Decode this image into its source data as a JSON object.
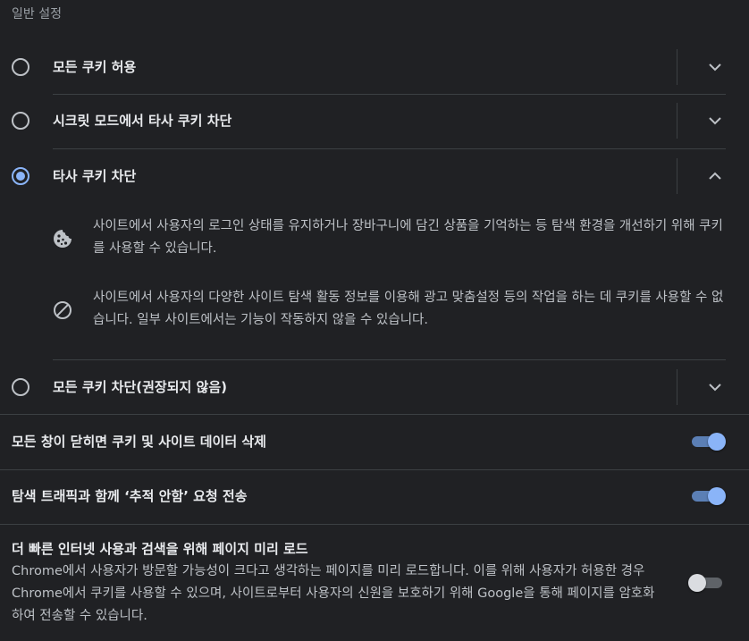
{
  "section": {
    "title": "일반 설정"
  },
  "cookie_options": [
    {
      "label": "모든 쿠키 허용",
      "selected": false,
      "expanded": false
    },
    {
      "label": "시크릿 모드에서 타사 쿠키 차단",
      "selected": false,
      "expanded": false
    },
    {
      "label": "타사 쿠키 차단",
      "selected": true,
      "expanded": true
    },
    {
      "label": "모든 쿠키 차단(권장되지 않음)",
      "selected": false,
      "expanded": false
    }
  ],
  "third_party_details": [
    {
      "icon": "cookie-icon",
      "text": "사이트에서 사용자의 로그인 상태를 유지하거나 장바구니에 담긴 상품을 기억하는 등 탐색 환경을 개선하기 위해 쿠키를 사용할 수 있습니다."
    },
    {
      "icon": "block-icon",
      "text": "사이트에서 사용자의 다양한 사이트 탐색 활동 정보를 이용해 광고 맞춤설정 등의 작업을 하는 데 쿠키를 사용할 수 없습니다. 일부 사이트에서는 기능이 작동하지 않을 수 있습니다."
    }
  ],
  "toggles": [
    {
      "label": "모든 창이 닫히면 쿠키 및 사이트 데이터 삭제",
      "on": true
    },
    {
      "label": "탐색 트래픽과 함께 ‘추적 안함’ 요청 전송",
      "on": true
    },
    {
      "label": "더 빠른 인터넷 사용과 검색을 위해 페이지 미리 로드",
      "description": "Chrome에서 사용자가 방문할 가능성이 크다고 생각하는 페이지를 미리 로드합니다. 이를 위해 사용자가 허용한 경우 Chrome에서 쿠키를 사용할 수 있으며, 사이트로부터 사용자의 신원을 보호하기 위해 Google을 통해 페이지를 암호화하여 전송할 수 있습니다.",
      "on": false
    }
  ],
  "colors": {
    "background": "#202124",
    "accent": "#8ab4f8",
    "divider": "#3c4043"
  }
}
